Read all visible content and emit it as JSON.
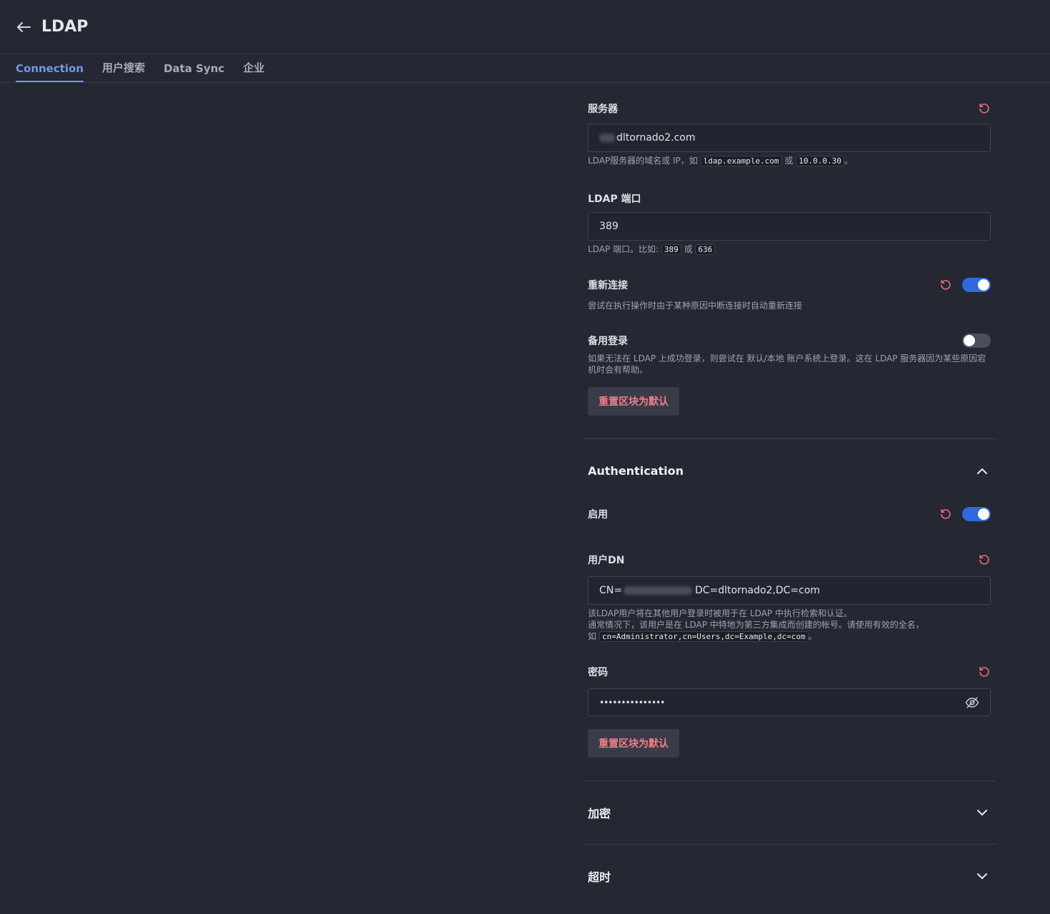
{
  "header": {
    "title": "LDAP"
  },
  "tabs": [
    {
      "label": "Connection"
    },
    {
      "label": "用户搜索"
    },
    {
      "label": "Data Sync"
    },
    {
      "label": "企业"
    }
  ],
  "connection": {
    "server": {
      "label": "服务器",
      "value": "dltornado2.com",
      "help_prefix": "LDAP服务器的域名或 IP，如",
      "help_code1": "ldap.example.com",
      "help_or": "或",
      "help_code2": "10.0.0.30",
      "help_suffix": "。"
    },
    "port": {
      "label": "LDAP 端口",
      "value": "389",
      "help_prefix": "LDAP 端口。比如:",
      "help_code1": "389",
      "help_or": "或",
      "help_code2": "636"
    },
    "reconnect": {
      "label": "重新连接",
      "help": "尝试在执行操作时由于某种原因中断连接时自动重新连接",
      "enabled": true
    },
    "fallback": {
      "label": "备用登录",
      "help": "如果无法在 LDAP 上成功登录，则尝试在 默认/本地 账户系统上登录。这在 LDAP 服务器因为某些原因宕机时会有帮助。",
      "enabled": false
    },
    "reset_label": "重置区块为默认"
  },
  "authentication": {
    "title": "Authentication",
    "enable": {
      "label": "启用",
      "enabled": true
    },
    "user_dn": {
      "label": "用户DN",
      "value_prefix": "CN=",
      "value_suffix": "DC=dltornado2,DC=com",
      "help1": "该LDAP用户将在其他用户登录时被用于在 LDAP 中执行检索和认证。",
      "help2": "通常情况下，该用户是在 LDAP 中特地为第三方集成而创建的帐号。请使用有效的全名，",
      "help3_prefix": "如",
      "help3_code": "cn=Administrator,cn=Users,dc=Example,dc=com",
      "help3_suffix": "。"
    },
    "password": {
      "label": "密码",
      "value": "•••••••••••••••"
    },
    "reset_label": "重置区块为默认"
  },
  "sections": {
    "encryption": "加密",
    "timeout": "超时"
  },
  "colors": {
    "accent": "#6f9ae8",
    "toggle_on": "#2f6ae0",
    "danger": "#f17e86"
  }
}
